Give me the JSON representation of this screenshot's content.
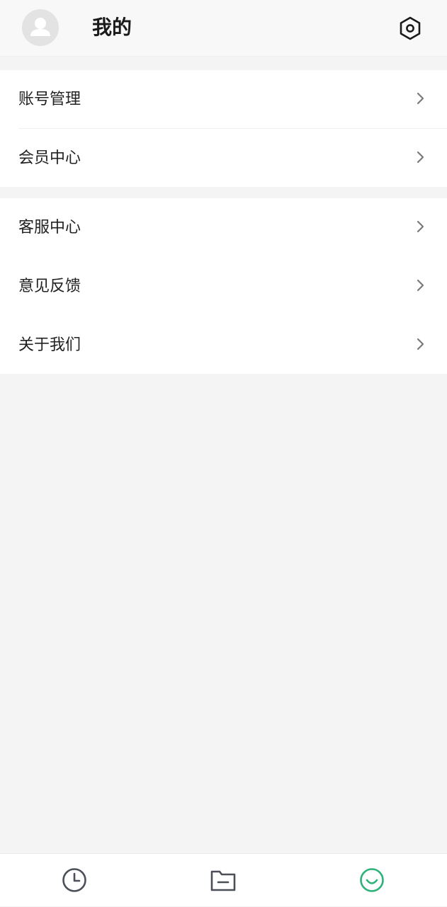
{
  "header": {
    "title": "我的",
    "avatar_icon": "user-avatar-icon",
    "settings_icon": "settings-hexagon-icon"
  },
  "menu_groups": [
    {
      "items": [
        {
          "label": "账号管理",
          "icon": "chevron-right-icon"
        },
        {
          "label": "会员中心",
          "icon": "chevron-right-icon"
        }
      ]
    },
    {
      "items": [
        {
          "label": "客服中心",
          "icon": "chevron-right-icon"
        },
        {
          "label": "意见反馈",
          "icon": "chevron-right-icon"
        },
        {
          "label": "关于我们",
          "icon": "chevron-right-icon"
        }
      ]
    }
  ],
  "tabbar": {
    "tabs": [
      {
        "icon": "clock-icon",
        "active": false
      },
      {
        "icon": "folder-icon",
        "active": false
      },
      {
        "icon": "smile-icon",
        "active": true
      }
    ]
  },
  "colors": {
    "accent": "#2db37a",
    "icon_inactive": "#4a4f58",
    "background": "#f4f4f4",
    "surface": "#ffffff"
  }
}
